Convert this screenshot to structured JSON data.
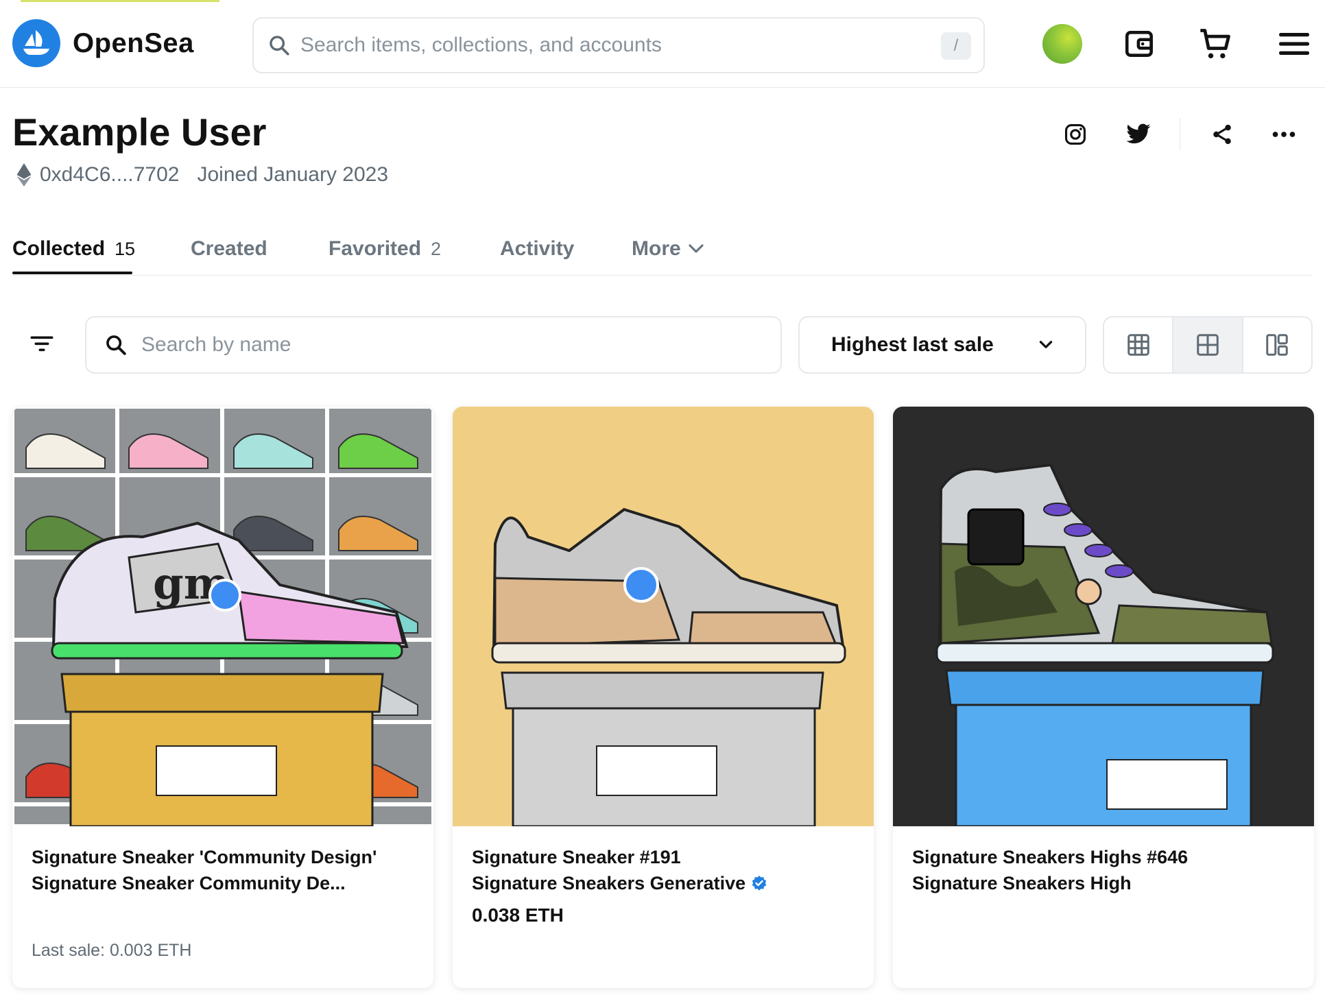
{
  "header": {
    "brand": "OpenSea",
    "search_placeholder": "Search items, collections, and accounts",
    "search_shortcut": "/"
  },
  "profile": {
    "name": "Example User",
    "address": "0xd4C6....7702",
    "joined": "Joined January 2023"
  },
  "tabs": [
    {
      "label": "Collected",
      "count": "15",
      "active": true
    },
    {
      "label": "Created",
      "count": ""
    },
    {
      "label": "Favorited",
      "count": "2"
    },
    {
      "label": "Activity",
      "count": ""
    },
    {
      "label": "More",
      "count": ""
    }
  ],
  "filters": {
    "name_search_placeholder": "Search by name",
    "sort_label": "Highest last sale"
  },
  "cards": [
    {
      "title": "Signature Sneaker 'Community Design'",
      "collection": "Signature Sneaker Community De...",
      "price": "",
      "last_sale": "Last sale: 0.003 ETH",
      "bg": "#f3f4f6"
    },
    {
      "title": "Signature Sneaker #191",
      "collection": "Signature Sneakers Generative",
      "verified": true,
      "price": "0.038 ETH",
      "last_sale": "",
      "bg": "#f0cf85"
    },
    {
      "title": "Signature Sneakers Highs #646",
      "collection": "Signature Sneakers High",
      "price": "",
      "last_sale": "",
      "bg": "#2b2b2b"
    }
  ],
  "colors": {
    "accent": "#2081e2",
    "text": "#121212",
    "muted": "#5f6a73",
    "border": "#e5e8eb"
  }
}
